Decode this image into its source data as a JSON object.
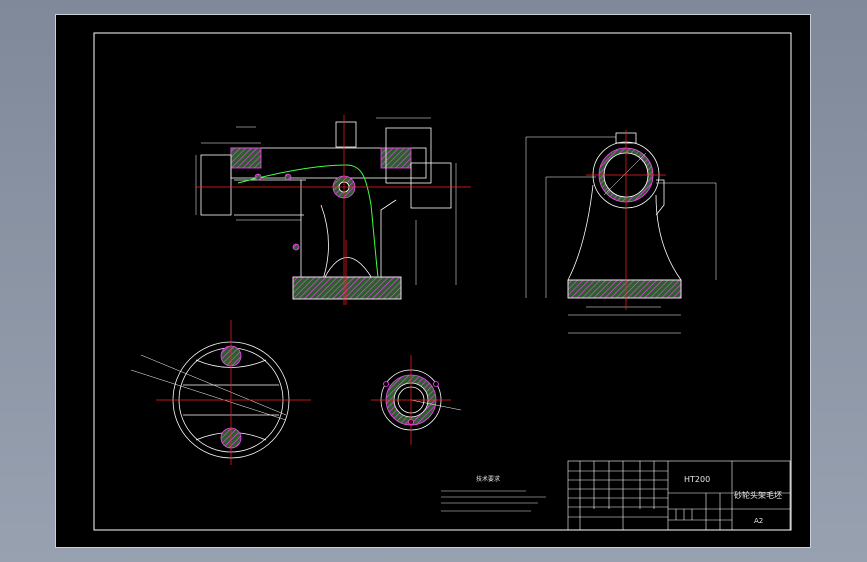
{
  "drawing": {
    "material": "HT200",
    "part_name": "砂轮头架毛坯",
    "sheet_size": "A2"
  },
  "notes": {
    "heading": "技术要求"
  },
  "colors": {
    "background": "#000000",
    "border": "#ffffff",
    "centerline": "#ff2020",
    "hatch": "#ff40ff",
    "fill": "#2e7d32",
    "outline": "#ffffff",
    "highlight": "#40ff40"
  }
}
